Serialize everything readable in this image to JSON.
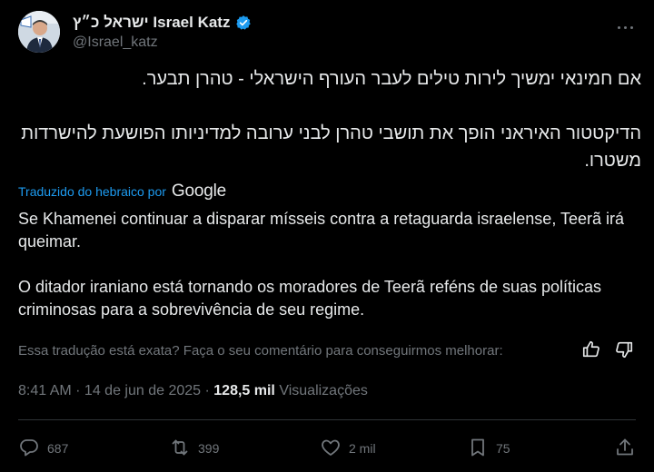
{
  "author": {
    "display_name": "ישראל כ״ץ Israel Katz",
    "handle": "@Israel_katz"
  },
  "tweet": {
    "hebrew_paragraphs": [
      "אם חמינאי ימשיך לירות טילים לעבר העורף הישראלי - טהרן תבער.",
      "הדיקטטור האיראני הופך את תושבי טהרן לבני ערובה למדיניותו הפושעת להישרדות משטרו."
    ],
    "translated_by_label": "Traduzido do hebraico por",
    "translated_by_brand": "Google",
    "translation_paragraphs": [
      "Se Khamenei continuar a disparar mísseis contra a retaguarda israelense, Teerã irá queimar.",
      "O ditador iraniano está tornando os moradores de Teerã reféns de suas políticas criminosas para a sobrevivência de seu regime."
    ],
    "feedback_prompt": "Essa tradução está exata? Faça o seu comentário para conseguirmos melhorar:",
    "time": "8:41 AM",
    "separator": " · ",
    "date": "14 de jun de 2025",
    "views_count": "128,5 mil",
    "views_label": "Visualizações"
  },
  "actions": {
    "replies": "687",
    "reposts": "399",
    "likes": "2 mil",
    "bookmarks": "75"
  },
  "colors": {
    "background": "#000000",
    "text": "#e7e9ea",
    "muted": "#71767b",
    "accent": "#1d9bf0",
    "divider": "#2f3336"
  },
  "icons": [
    "verified-badge-icon",
    "more-icon",
    "thumbs-up-icon",
    "thumbs-down-icon",
    "reply-icon",
    "repost-icon",
    "like-icon",
    "bookmark-icon",
    "share-icon"
  ]
}
